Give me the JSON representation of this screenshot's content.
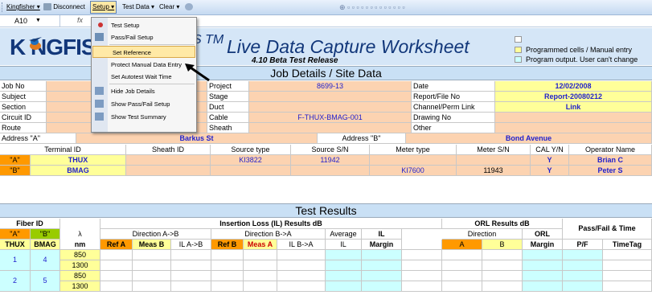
{
  "toolbar": {
    "kingfisher": "Kingfisher ▾",
    "disconnect": "Disconnect",
    "setup": "Setup ▾",
    "testdata": "Test Data ▾",
    "clear": "Clear ▾"
  },
  "namebox": {
    "cell": "A10",
    "fx": "fx"
  },
  "menu": {
    "items": [
      "Test Setup",
      "Pass/Fail Setup",
      "Set Reference",
      "Protect Manual Data Entry",
      "Set Autotest Wait Time",
      "Hide Job Details",
      "Show Pass/Fail Setup",
      "Show Test Summary"
    ]
  },
  "header": {
    "logo": "K NGFIS",
    "tm": "S TM",
    "title": "Live Data Capture Worksheet",
    "subtitle": "4.10 Beta Test Release",
    "legend1": "Programmed cells / Manual entry",
    "legend2": "Program output. User can't change"
  },
  "job": {
    "band": "Job Details / Site Data",
    "left": [
      "Job No",
      "Subject",
      "Section",
      "Circuit ID",
      "Route"
    ],
    "mid": [
      "Project",
      "Stage",
      "Duct",
      "Cable",
      "Sheath"
    ],
    "midvals": [
      "8699-13",
      "",
      "",
      "F-THUX-BMAG-001",
      ""
    ],
    "right": [
      "Date",
      "Report/File No",
      "Channel/Perm Link",
      "Drawing No",
      "Other"
    ],
    "rightvals": [
      "12/02/2008",
      "Report-20080212",
      "Link",
      "",
      ""
    ],
    "addrA": "Address \"A\"",
    "addrAval": "Barkus St",
    "addrB": "Address \"B\"",
    "addrBval": "Bond Avenue"
  },
  "term": {
    "headers": [
      "Terminal ID",
      "Sheath ID",
      "Source type",
      "Source S/N",
      "Meter type",
      "Meter S/N",
      "CAL Y/N",
      "Operator Name"
    ],
    "rows": [
      {
        "end": "\"A\"",
        "tid": "THUX",
        "stype": "KI3822",
        "ssn": "11942",
        "mtype": "",
        "msn": "",
        "cal": "Y",
        "op": "Brian C"
      },
      {
        "end": "\"B\"",
        "tid": "BMAG",
        "stype": "",
        "ssn": "",
        "mtype": "KI7600",
        "msn": "11943",
        "cal": "Y",
        "op": "Peter S"
      }
    ]
  },
  "results": {
    "band": "Test Results",
    "fiber": "Fiber ID",
    "lambda": "λ",
    "il": "Insertion Loss (IL) Results dB",
    "orl": "ORL Results dB",
    "pf": "Pass/Fail & Time",
    "a": "\"A\"",
    "b": "\"B\"",
    "dirAB": "Direction A->B",
    "dirBA": "Direction B->A",
    "avg": "Average",
    "il2": "IL",
    "dir": "Direction",
    "orl2": "ORL",
    "cols": [
      "THUX",
      "BMAG",
      "nm",
      "Ref A",
      "Meas B",
      "IL A->B",
      "Ref B",
      "Meas A",
      "IL B->A",
      "IL",
      "Margin",
      "A",
      "B",
      "Margin",
      "P/F",
      "TimeTag"
    ],
    "rows": [
      {
        "a": "1",
        "b": "4",
        "nm1": "850",
        "nm2": "1300"
      },
      {
        "a": "2",
        "b": "5",
        "nm1": "850",
        "nm2": "1300"
      }
    ]
  }
}
